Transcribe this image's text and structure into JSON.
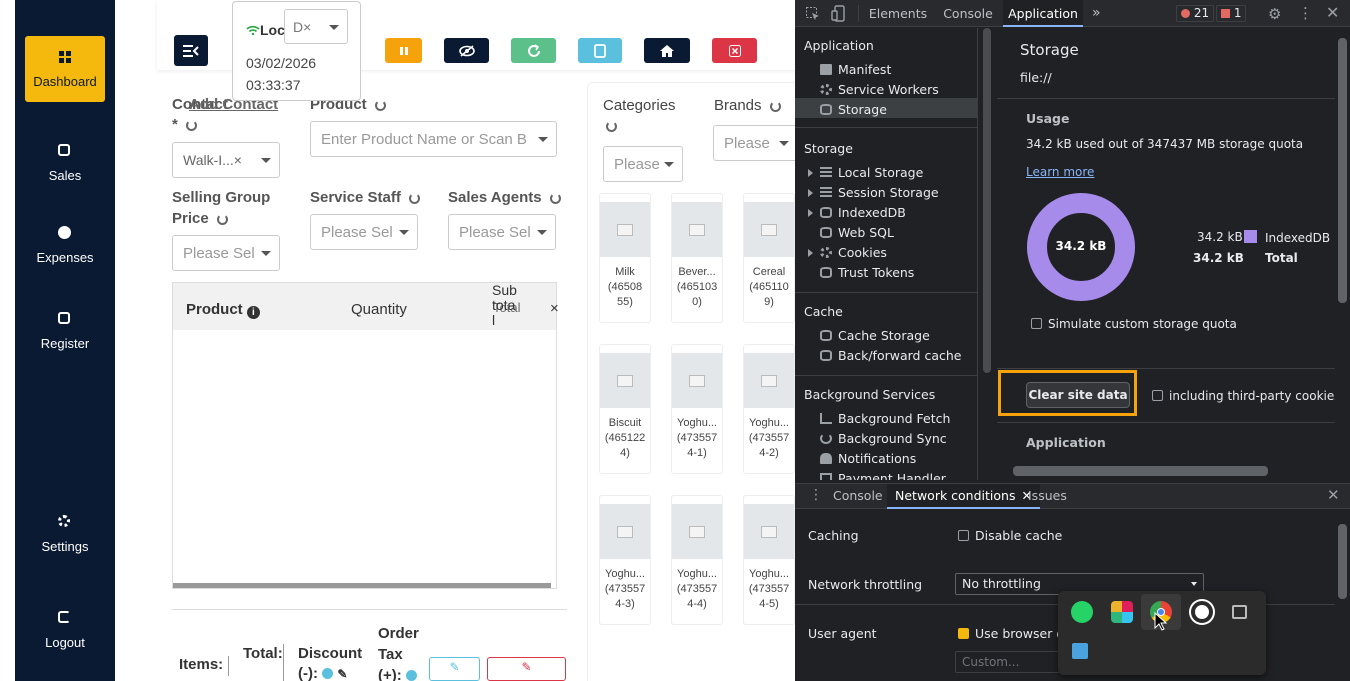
{
  "pos": {
    "nav": [
      {
        "label": "Dashboard",
        "icon": "dashboard-icon"
      },
      {
        "label": "Sales",
        "icon": "sales-icon"
      },
      {
        "label": "Expenses",
        "icon": "expenses-icon"
      },
      {
        "label": "Register",
        "icon": "register-icon"
      },
      {
        "label": "Settings",
        "icon": "settings-icon"
      },
      {
        "label": "Logout",
        "icon": "logout-icon"
      }
    ],
    "location_popup": {
      "label": "Loc",
      "select_value": "D×",
      "date": "03/02/2026",
      "time": "03:33:37"
    },
    "toolbar_colors": {
      "pause": "#f5a20d",
      "hide": "#0b1a33",
      "refresh": "#5bc08a",
      "tablet": "#5bc0de",
      "home": "#0b1a33",
      "close": "#dc3545"
    },
    "contact": {
      "label_a": "Contact",
      "label_b": "Add Contact",
      "required": "*",
      "value": "Walk-I...×"
    },
    "product": {
      "label": "Product",
      "placeholder": "Enter Product Name or Scan B"
    },
    "selling_group": {
      "label_line1": "Selling Group",
      "label_line2": "Price",
      "placeholder": "Please Sel"
    },
    "service_staff": {
      "label": "Service Staff",
      "placeholder": "Please Sel"
    },
    "sales_agents": {
      "label": "Sales Agents",
      "placeholder": "Please Sel"
    },
    "cart_headers": {
      "product": "Product",
      "quantity": "Quantity",
      "subtotal_line1": "Sub",
      "subtotal_line2": "tota",
      "subtotal_line3": "l",
      "total_overlap": "Total",
      "close": "×"
    },
    "categories": {
      "label": "Categories",
      "placeholder": "Please"
    },
    "brands": {
      "label": "Brands",
      "placeholder": "Please"
    },
    "products": [
      {
        "name": "Milk",
        "code_line1": "(46508",
        "code_line2": "55)"
      },
      {
        "name": "Bever...",
        "code_line1": "(465103",
        "code_line2": "0)"
      },
      {
        "name": "Cereal",
        "code_line1": "(465110",
        "code_line2": "9)"
      },
      {
        "name": "Biscuit",
        "code_line1": "(465122",
        "code_line2": "4)"
      },
      {
        "name": "Yoghu...",
        "code_line1": "(473557",
        "code_line2": "4-1)"
      },
      {
        "name": "Yoghu...",
        "code_line1": "(473557",
        "code_line2": "4-2)"
      },
      {
        "name": "Yoghu...",
        "code_line1": "(473557",
        "code_line2": "4-3)"
      },
      {
        "name": "Yoghu...",
        "code_line1": "(473557",
        "code_line2": "4-4)"
      },
      {
        "name": "Yoghu...",
        "code_line1": "(473557",
        "code_line2": "4-5)"
      }
    ],
    "footer": {
      "items": "Items:",
      "total": "Total:",
      "discount_line1": "Discount",
      "discount_line2": "(-):",
      "order_tax_line1": "Order",
      "order_tax_line2": "Tax",
      "order_tax_line3": "(+):"
    }
  },
  "devtools": {
    "tabs": [
      "Elements",
      "Console",
      "Application"
    ],
    "active_tab": "Application",
    "error_count": "21",
    "warning_count": "1",
    "tree": {
      "application_header": "Application",
      "application_items": [
        "Manifest",
        "Service Workers",
        "Storage"
      ],
      "storage_header": "Storage",
      "storage_items": [
        "Local Storage",
        "Session Storage",
        "IndexedDB",
        "Web SQL",
        "Cookies",
        "Trust Tokens"
      ],
      "cache_header": "Cache",
      "cache_items": [
        "Cache Storage",
        "Back/forward cache"
      ],
      "background_header": "Background Services",
      "background_items": [
        "Background Fetch",
        "Background Sync",
        "Notifications",
        "Payment Handler"
      ]
    },
    "storage_panel": {
      "title": "Storage",
      "origin": "file://",
      "usage_header": "Usage",
      "usage_text": "34.2 kB used out of 347437 MB storage quota",
      "learn_more": "Learn more",
      "donut_center": "34.2 kB",
      "legend_value": "34.2 kB",
      "legend_name": "IndexedDB",
      "total_value": "34.2 kB",
      "total_label": "Total",
      "legend_color": "#a78bea",
      "simulate_label": "Simulate custom storage quota",
      "clear_button": "Clear site data",
      "third_party_label": "including third-party cookies",
      "application_header": "Application",
      "highlight_color": "#f5a20d"
    },
    "drawer": {
      "tabs": [
        "Console",
        "Network conditions",
        "Issues"
      ],
      "active_tab": "Network conditions",
      "caching_label": "Caching",
      "disable_cache": "Disable cache",
      "throttling_label": "Network throttling",
      "throttling_value": "No throttling",
      "user_agent_label": "User agent",
      "use_browser_default": "Use browser de",
      "custom_placeholder": "Custom..."
    }
  },
  "dock": {
    "apps": [
      "whatsapp-icon",
      "slack-icon",
      "chrome-icon",
      "grammarly-icon",
      "screen-icon",
      "image-app-icon"
    ]
  }
}
